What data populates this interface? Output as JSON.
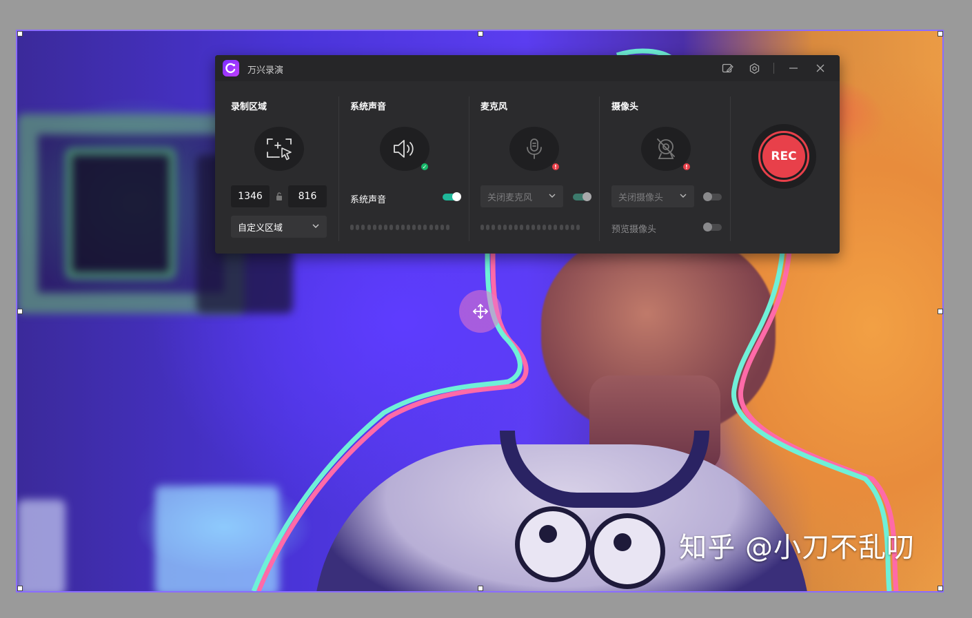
{
  "app": {
    "title": "万兴录演"
  },
  "sections": {
    "region": {
      "title": "录制区域",
      "width": "1346",
      "height": "816",
      "mode_selected": "自定义区域"
    },
    "system_audio": {
      "title": "系统声音",
      "toggle_label": "系统声音",
      "toggle_on": true,
      "status": "ok"
    },
    "microphone": {
      "title": "麦克风",
      "device_selected": "关闭麦克风",
      "toggle_on": true,
      "status": "error"
    },
    "camera": {
      "title": "摄像头",
      "device_selected": "关闭摄像头",
      "toggle_on": false,
      "preview_label": "预览摄像头",
      "preview_on": false,
      "status": "error"
    }
  },
  "rec_button": {
    "label": "REC",
    "color": "#e8404a"
  },
  "icons": {
    "titlebar": [
      "edit-note-icon",
      "settings-gear-icon",
      "minimize-icon",
      "close-icon"
    ],
    "sections": [
      "region-select-icon",
      "speaker-icon",
      "microphone-icon",
      "camera-off-icon"
    ],
    "overlay": "move-arrows-icon"
  },
  "watermark": {
    "text": "知乎 @小刀不乱叨"
  },
  "colors": {
    "selection_border": "#8a6cff",
    "accent_toggle": "#1fb89a",
    "ok": "#18b86a",
    "error": "#e8404a"
  }
}
